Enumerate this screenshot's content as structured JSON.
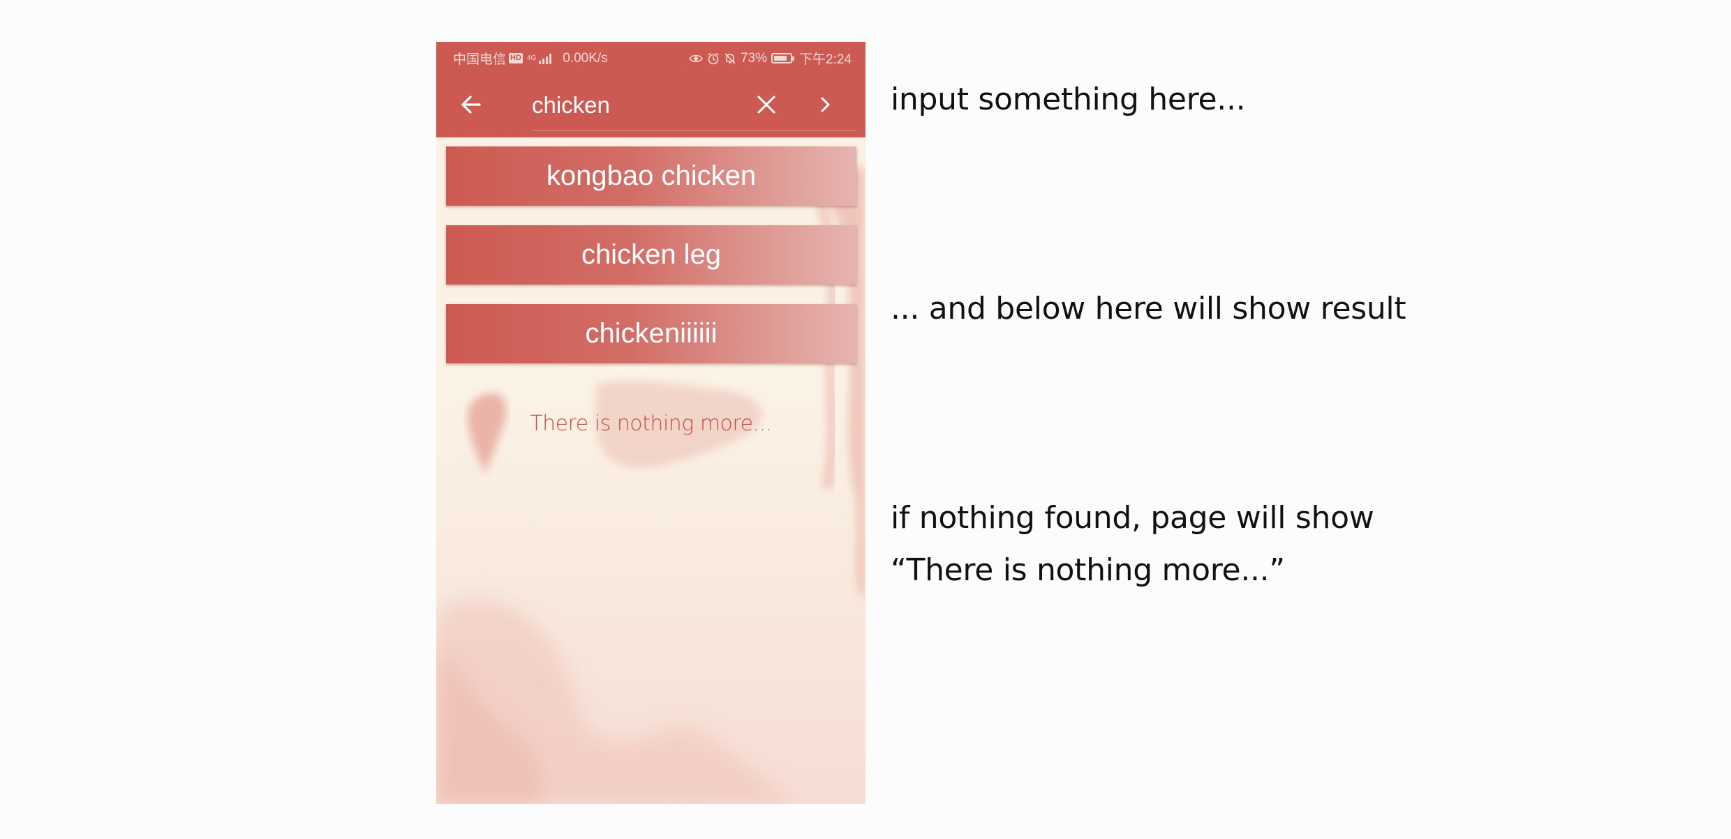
{
  "status_bar": {
    "carrier": "中国电信",
    "hd_badge": "HD",
    "network": "4G",
    "speed": "0.00K/s",
    "battery": "73%",
    "time": "下午2:24",
    "icons": [
      "eye-icon",
      "alarm-icon",
      "bell-off-icon",
      "battery-icon"
    ]
  },
  "search": {
    "value": "chicken",
    "back_icon": "arrow-left-icon",
    "clear_icon": "close-icon",
    "forward_icon": "chevron-right-icon"
  },
  "results": [
    {
      "label": "kongbao chicken"
    },
    {
      "label": "chicken leg"
    },
    {
      "label": "chickeniiiiii"
    }
  ],
  "empty_message": "There is nothing more...",
  "annotations": {
    "input_hint": "input something here...",
    "result_hint": "... and below here will show result",
    "empty_hint_line1": "if nothing found, page will show",
    "empty_hint_line2": "“There is nothing more...”"
  },
  "colors": {
    "primary": "#cd5a52",
    "result_gradient_end": "#e6b4b0",
    "empty_text": "#c84c44",
    "page_bg": "#fcfcfc"
  }
}
